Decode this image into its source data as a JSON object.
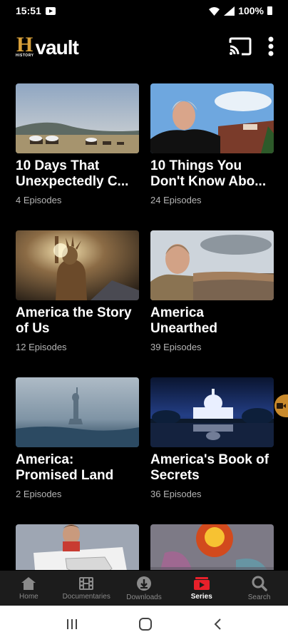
{
  "status_bar": {
    "time": "15:51",
    "battery": "100%"
  },
  "app": {
    "logo_letter": "H",
    "logo_text": "vault",
    "logo_sub": "HISTORY"
  },
  "series": [
    {
      "title": "10 Days That Unexpectedly C...",
      "episodes": "4 Episodes"
    },
    {
      "title": "10 Things You Don't Know Abo...",
      "episodes": "24 Episodes"
    },
    {
      "title": "America the Story of Us",
      "episodes": "12 Episodes"
    },
    {
      "title": "America Unearthed",
      "episodes": "39 Episodes"
    },
    {
      "title": "America: Promised Land",
      "episodes": "2 Episodes"
    },
    {
      "title": "America's Book of Secrets",
      "episodes": "36 Episodes"
    }
  ],
  "bottom_nav": [
    {
      "label": "Home",
      "icon": "home-icon"
    },
    {
      "label": "Documentaries",
      "icon": "film-icon"
    },
    {
      "label": "Downloads",
      "icon": "download-icon"
    },
    {
      "label": "Series",
      "icon": "series-icon",
      "active": true
    },
    {
      "label": "Search",
      "icon": "search-icon"
    }
  ],
  "colors": {
    "accent": "#e8202a",
    "logo_gold": "#d9a13a",
    "background": "#000000",
    "nav_background": "#1c1c1c"
  }
}
